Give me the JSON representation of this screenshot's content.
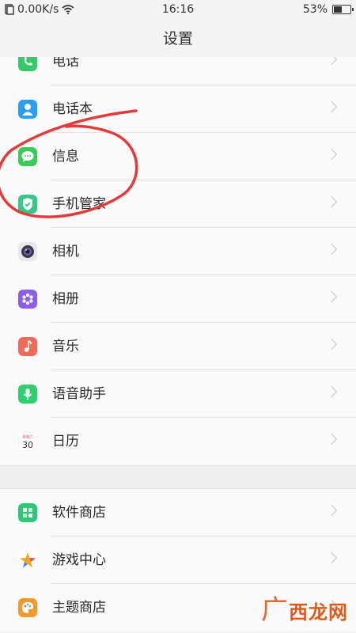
{
  "status_bar": {
    "network_speed": "0.00K/s",
    "time": "16:16",
    "battery_percent": "53%",
    "battery_level": 0.53
  },
  "header": {
    "title": "设置"
  },
  "section1": [
    {
      "label": "电话",
      "icon": "phone-icon",
      "color": "#37c86a"
    },
    {
      "label": "电话本",
      "icon": "contacts-icon",
      "color": "#2a9df4"
    },
    {
      "label": "信息",
      "icon": "message-icon",
      "color": "#3ccb5a"
    },
    {
      "label": "手机管家",
      "icon": "shield-icon",
      "color": "#34c88a"
    },
    {
      "label": "相机",
      "icon": "camera-icon",
      "color": "#6b6b6b"
    },
    {
      "label": "相册",
      "icon": "photos-icon",
      "color": "#8a5cf0"
    },
    {
      "label": "音乐",
      "icon": "music-icon",
      "color": "#f06a5a"
    },
    {
      "label": "语音助手",
      "icon": "voice-assistant-icon",
      "color": "#2fcf6f"
    },
    {
      "label": "日历",
      "icon": "calendar-icon",
      "color": "#f05050"
    }
  ],
  "calendar_icon": {
    "day": "30",
    "header": "星期六"
  },
  "section2": [
    {
      "label": "软件商店",
      "icon": "app-store-icon",
      "color": "#2ec778"
    },
    {
      "label": "游戏中心",
      "icon": "game-center-icon",
      "color": "#f39c2a"
    },
    {
      "label": "主题商店",
      "icon": "theme-store-icon",
      "color": "#f39a2a"
    }
  ],
  "watermark": {
    "text_big": "广",
    "text": "西龙网"
  }
}
